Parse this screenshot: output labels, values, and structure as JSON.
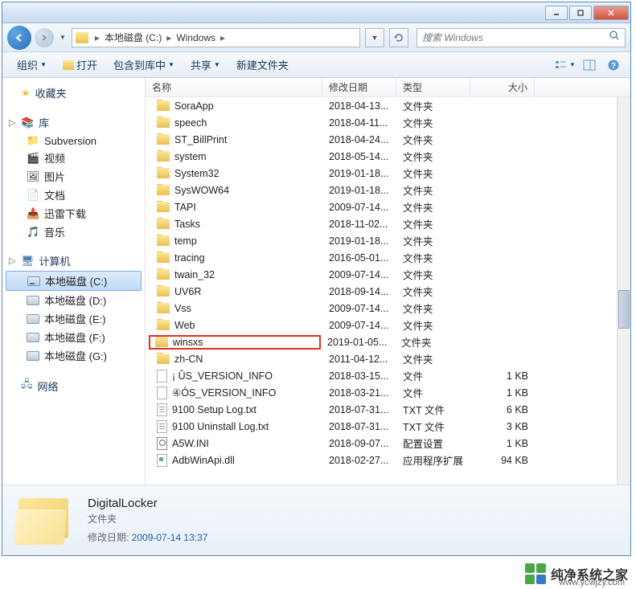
{
  "address": {
    "segments": [
      "本地磁盘 (C:)",
      "Windows"
    ]
  },
  "search": {
    "placeholder": "搜索 Windows"
  },
  "toolbar": {
    "organize": "组织",
    "open": "打开",
    "include": "包含到库中",
    "share": "共享",
    "newfolder": "新建文件夹"
  },
  "sidebar": {
    "favorites": "收藏夹",
    "libraries": "库",
    "lib_items": [
      "Subversion",
      "视频",
      "图片",
      "文档",
      "迅雷下载",
      "音乐"
    ],
    "computer": "计算机",
    "drives": [
      "本地磁盘 (C:)",
      "本地磁盘 (D:)",
      "本地磁盘 (E:)",
      "本地磁盘 (F:)",
      "本地磁盘 (G:)"
    ],
    "network": "网络"
  },
  "columns": {
    "name": "名称",
    "date": "修改日期",
    "type": "类型",
    "size": "大小"
  },
  "files": [
    {
      "name": "SoraApp",
      "date": "2018-04-13...",
      "type": "文件夹",
      "size": "",
      "icon": "folder"
    },
    {
      "name": "speech",
      "date": "2018-04-11...",
      "type": "文件夹",
      "size": "",
      "icon": "folder"
    },
    {
      "name": "ST_BillPrint",
      "date": "2018-04-24...",
      "type": "文件夹",
      "size": "",
      "icon": "folder"
    },
    {
      "name": "system",
      "date": "2018-05-14...",
      "type": "文件夹",
      "size": "",
      "icon": "folder"
    },
    {
      "name": "System32",
      "date": "2019-01-18...",
      "type": "文件夹",
      "size": "",
      "icon": "folder"
    },
    {
      "name": "SysWOW64",
      "date": "2019-01-18...",
      "type": "文件夹",
      "size": "",
      "icon": "folder"
    },
    {
      "name": "TAPI",
      "date": "2009-07-14...",
      "type": "文件夹",
      "size": "",
      "icon": "folder"
    },
    {
      "name": "Tasks",
      "date": "2018-11-02...",
      "type": "文件夹",
      "size": "",
      "icon": "folder"
    },
    {
      "name": "temp",
      "date": "2019-01-18...",
      "type": "文件夹",
      "size": "",
      "icon": "folder"
    },
    {
      "name": "tracing",
      "date": "2016-05-01...",
      "type": "文件夹",
      "size": "",
      "icon": "folder"
    },
    {
      "name": "twain_32",
      "date": "2009-07-14...",
      "type": "文件夹",
      "size": "",
      "icon": "folder"
    },
    {
      "name": "UV6R",
      "date": "2018-09-14...",
      "type": "文件夹",
      "size": "",
      "icon": "folder"
    },
    {
      "name": "Vss",
      "date": "2009-07-14...",
      "type": "文件夹",
      "size": "",
      "icon": "folder"
    },
    {
      "name": "Web",
      "date": "2009-07-14...",
      "type": "文件夹",
      "size": "",
      "icon": "folder"
    },
    {
      "name": "winsxs",
      "date": "2019-01-05...",
      "type": "文件夹",
      "size": "",
      "icon": "folder",
      "highlight": true
    },
    {
      "name": "zh-CN",
      "date": "2011-04-12...",
      "type": "文件夹",
      "size": "",
      "icon": "folder"
    },
    {
      "name": "¡ ÛS_VERSION_INFO",
      "date": "2018-03-15...",
      "type": "文件",
      "size": "1 KB",
      "icon": "file"
    },
    {
      "name": "④ÓS_VERSION_INFO",
      "date": "2018-03-21...",
      "type": "文件",
      "size": "1 KB",
      "icon": "file"
    },
    {
      "name": "9100 Setup Log.txt",
      "date": "2018-07-31...",
      "type": "TXT 文件",
      "size": "6 KB",
      "icon": "txt"
    },
    {
      "name": "9100 Uninstall Log.txt",
      "date": "2018-07-31...",
      "type": "TXT 文件",
      "size": "3 KB",
      "icon": "txt"
    },
    {
      "name": "A5W.INI",
      "date": "2018-09-07...",
      "type": "配置设置",
      "size": "1 KB",
      "icon": "ini"
    },
    {
      "name": "AdbWinApi.dll",
      "date": "2018-02-27...",
      "type": "应用程序扩展",
      "size": "94 KB",
      "icon": "dll"
    }
  ],
  "details": {
    "title": "DigitalLocker",
    "type": "文件夹",
    "date_label": "修改日期:",
    "date_value": "2009-07-14 13:37"
  },
  "watermark": {
    "text": "纯净系统之家",
    "url": "www.ycwjzy.com"
  }
}
